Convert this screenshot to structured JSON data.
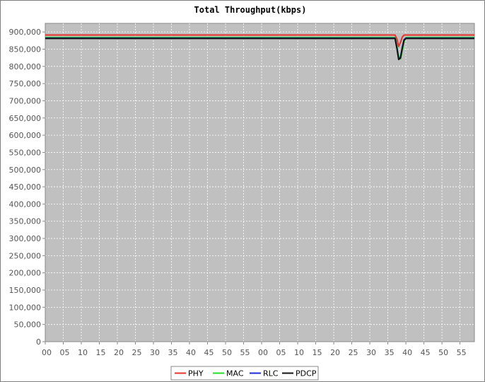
{
  "chart_data": {
    "type": "line",
    "title": "Total Throughput(kbps)",
    "xlabel": "",
    "ylabel": "",
    "ylim": [
      0,
      925000
    ],
    "yticks": [
      0,
      50000,
      100000,
      150000,
      200000,
      250000,
      300000,
      350000,
      400000,
      450000,
      500000,
      550000,
      600000,
      650000,
      700000,
      750000,
      800000,
      850000,
      900000
    ],
    "ytick_labels": [
      "0",
      "50,000",
      "100,000",
      "150,000",
      "200,000",
      "250,000",
      "300,000",
      "350,000",
      "400,000",
      "450,000",
      "500,000",
      "550,000",
      "600,000",
      "650,000",
      "700,000",
      "750,000",
      "800,000",
      "850,000",
      "900,000"
    ],
    "xlim": [
      0,
      119
    ],
    "xticks": [
      0,
      5,
      10,
      15,
      20,
      25,
      30,
      35,
      40,
      45,
      50,
      55,
      60,
      65,
      70,
      75,
      80,
      85,
      90,
      95,
      100,
      105,
      110,
      115
    ],
    "xtick_labels": [
      "00",
      "05",
      "10",
      "15",
      "20",
      "25",
      "30",
      "35",
      "40",
      "45",
      "50",
      "55",
      "00",
      "05",
      "10",
      "15",
      "20",
      "25",
      "30",
      "35",
      "40",
      "45",
      "50",
      "55"
    ],
    "grid": true,
    "legend_position": "bottom",
    "series": [
      {
        "name": "PHY",
        "color": "#e8312a",
        "x": [
          0,
          97,
          97.5,
          98,
          98.5,
          99,
          99.5,
          100,
          119
        ],
        "y": [
          891000,
          891000,
          880000,
          858000,
          870000,
          885000,
          891000,
          891000,
          891000
        ]
      },
      {
        "name": "MAC",
        "color": "#22e022",
        "x": [
          0,
          97,
          97.5,
          98,
          98.5,
          99,
          99.5,
          100,
          100.5,
          119
        ],
        "y": [
          884000,
          884000,
          860000,
          828000,
          822000,
          845000,
          872000,
          884000,
          884000,
          884000
        ]
      },
      {
        "name": "RLC",
        "color": "#1a2ad8",
        "x": [
          0,
          97,
          97.5,
          98,
          98.5,
          99,
          99.5,
          100,
          119
        ],
        "y": [
          882000,
          882000,
          855000,
          822000,
          826000,
          855000,
          878000,
          882000,
          882000
        ]
      },
      {
        "name": "PDCP",
        "color": "#111111",
        "x": [
          0,
          97,
          97.5,
          98,
          98.5,
          99,
          99.5,
          100,
          119
        ],
        "y": [
          881000,
          881000,
          853000,
          820000,
          824000,
          852000,
          876000,
          881000,
          881000
        ]
      }
    ]
  }
}
